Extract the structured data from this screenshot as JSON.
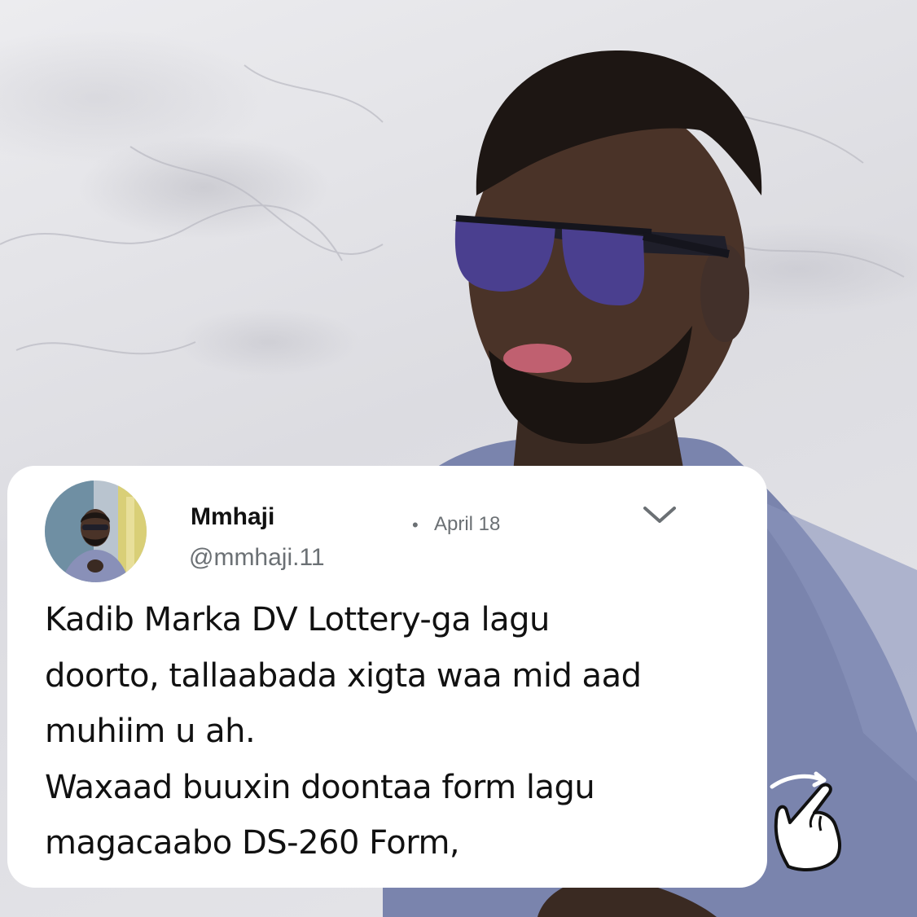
{
  "tweet": {
    "display_name": "Mmhaji",
    "handle": "@mmhaji.11",
    "separator": "•",
    "date": "April 18",
    "menu_icon": "chevron-down-icon",
    "text_lines": [
      "Kadib Marka DV Lottery-ga lagu",
      "doorto, tallaabada xigta waa mid aad",
      "muhiim u ah.",
      "Waxaad buuxin doontaa form lagu",
      "magacaabo DS-260 Form,"
    ]
  },
  "decorations": {
    "pointer_icon": "pointing-hand-icon"
  },
  "colors": {
    "card": "#ffffff",
    "name": "#111111",
    "meta": "#6b7074",
    "shirt": "#7a84ad",
    "lens": "#4a3f8f"
  }
}
